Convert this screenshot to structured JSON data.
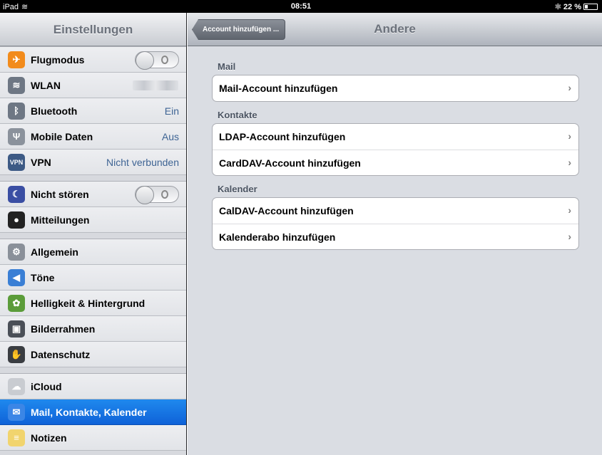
{
  "status": {
    "device": "iPad",
    "time": "08:51",
    "battery": "22 %",
    "bluetooth": "✱"
  },
  "sidebar": {
    "title": "Einstellungen",
    "groups": [
      [
        {
          "label": "Flugmodus",
          "icon": "airplane-icon",
          "control": "toggle",
          "color": "#f28b1c"
        },
        {
          "label": "WLAN",
          "icon": "wifi-icon",
          "control": "blurred",
          "color": "#6e7784"
        },
        {
          "label": "Bluetooth",
          "icon": "bluetooth-icon",
          "value": "Ein",
          "color": "#6e7784"
        },
        {
          "label": "Mobile Daten",
          "icon": "antenna-icon",
          "value": "Aus",
          "color": "#8b929c"
        },
        {
          "label": "VPN",
          "icon": "vpn-icon",
          "value": "Nicht verbunden",
          "color": "#3d5a85"
        }
      ],
      [
        {
          "label": "Nicht stören",
          "icon": "moon-icon",
          "control": "toggle",
          "color": "#3a4ea3"
        },
        {
          "label": "Mitteilungen",
          "icon": "notifications-icon",
          "color": "#222222"
        }
      ],
      [
        {
          "label": "Allgemein",
          "icon": "gear-icon",
          "color": "#8a9099"
        },
        {
          "label": "Töne",
          "icon": "speaker-icon",
          "color": "#3a7fd5"
        },
        {
          "label": "Helligkeit & Hintergrund",
          "icon": "flower-icon",
          "color": "#5b9c3a"
        },
        {
          "label": "Bilderrahmen",
          "icon": "picture-frame-icon",
          "color": "#4a4f57"
        },
        {
          "label": "Datenschutz",
          "icon": "hand-icon",
          "color": "#3a3d42"
        }
      ],
      [
        {
          "label": "iCloud",
          "icon": "cloud-icon",
          "color": "#c9ccd1"
        },
        {
          "label": "Mail, Kontakte, Kalender",
          "icon": "mail-icon",
          "color": "#3b86e6",
          "active": true
        },
        {
          "label": "Notizen",
          "icon": "notes-icon",
          "color": "#f1d46e"
        }
      ]
    ]
  },
  "nav": {
    "back_label": "Account hinzufügen ...",
    "title": "Andere"
  },
  "sections": [
    {
      "label": "Mail",
      "rows": [
        "Mail-Account hinzufügen"
      ]
    },
    {
      "label": "Kontakte",
      "rows": [
        "LDAP-Account hinzufügen",
        "CardDAV-Account hinzufügen"
      ]
    },
    {
      "label": "Kalender",
      "rows": [
        "CalDAV-Account hinzufügen",
        "Kalenderabo hinzufügen"
      ]
    }
  ],
  "icons": {
    "airplane-icon": "✈",
    "wifi-icon": "≋",
    "bluetooth-icon": "ᛒ",
    "antenna-icon": "Ψ",
    "vpn-icon": "VPN",
    "moon-icon": "☾",
    "notifications-icon": "●",
    "gear-icon": "⚙",
    "speaker-icon": "◀",
    "flower-icon": "✿",
    "picture-frame-icon": "▣",
    "hand-icon": "✋",
    "cloud-icon": "☁",
    "mail-icon": "✉",
    "notes-icon": "≡"
  }
}
